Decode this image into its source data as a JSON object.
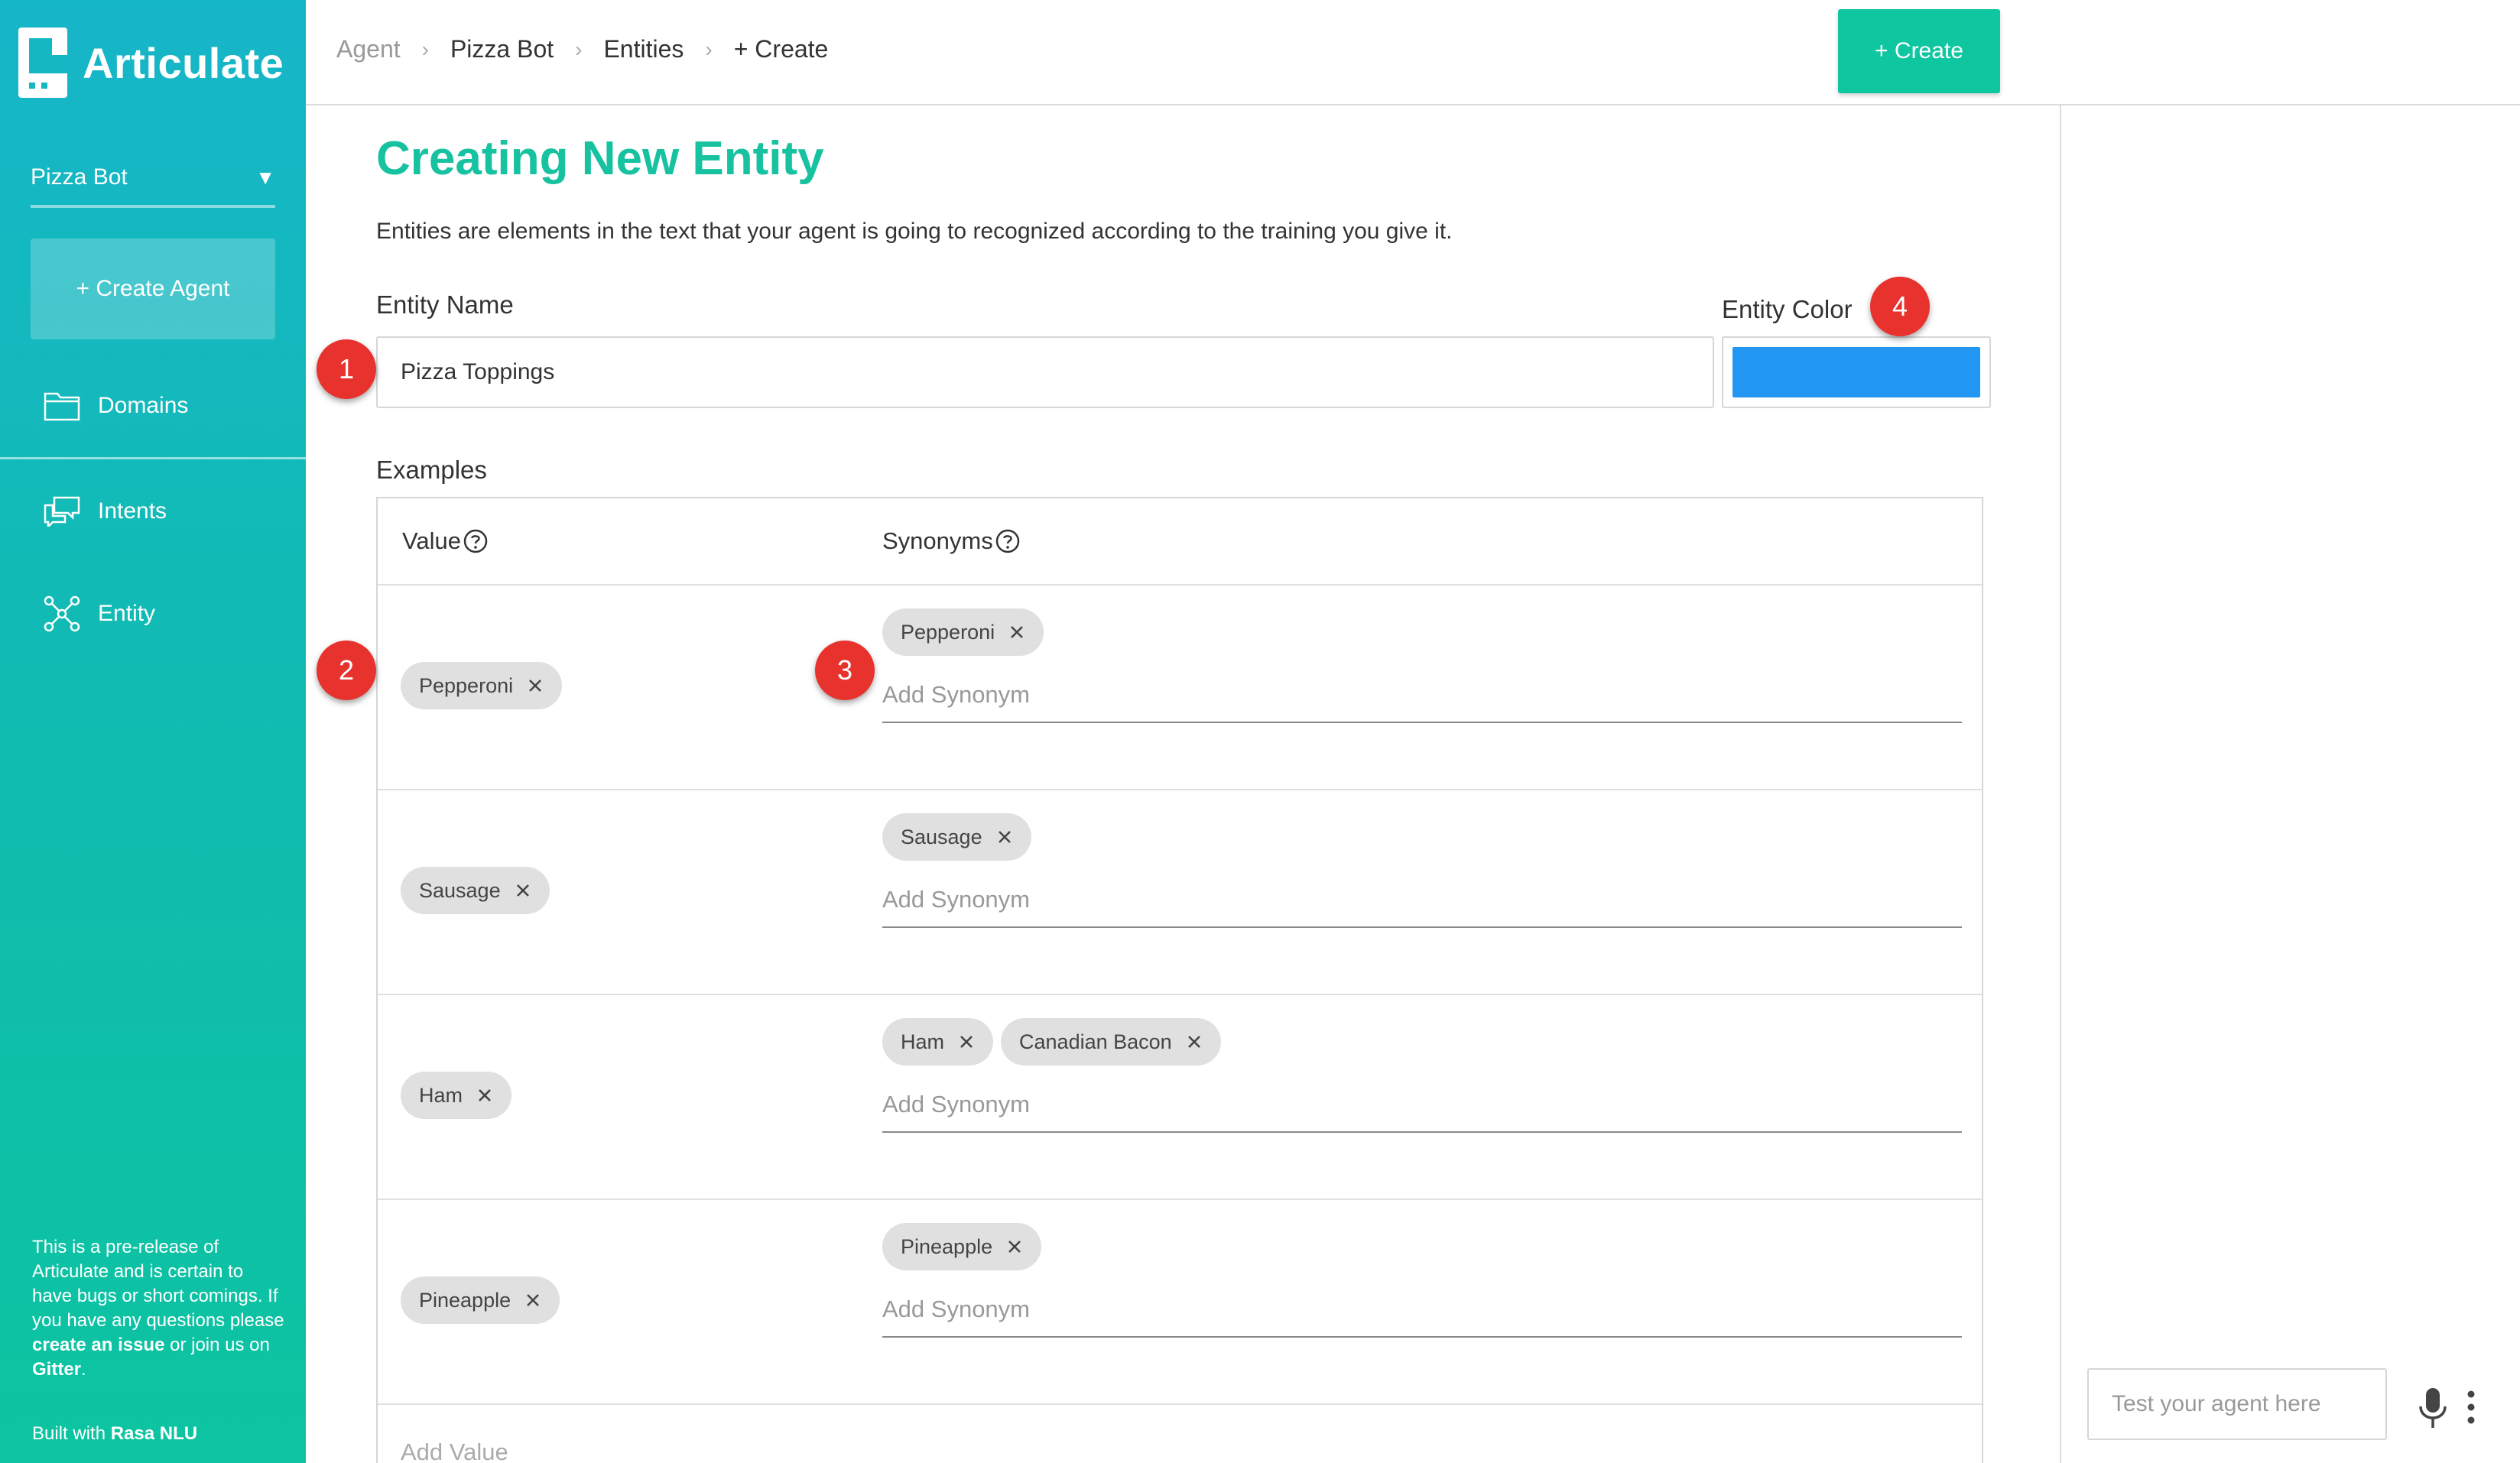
{
  "app": {
    "name": "Articulate",
    "colors": {
      "accent": "#0ec7a0",
      "sidebar_top": "#16b6c9",
      "sidebar_bottom": "#0cc4a0",
      "entity_color": "#2196f3",
      "callout": "#e8322e"
    }
  },
  "sidebar": {
    "agent_selected": "Pizza Bot",
    "create_agent_label": "+ Create Agent",
    "nav": [
      {
        "label": "Domains",
        "icon": "folder-icon"
      },
      {
        "label": "Intents",
        "icon": "chat-bubbles-icon"
      },
      {
        "label": "Entity",
        "icon": "network-nodes-icon"
      }
    ],
    "note": {
      "text1": "This is a pre-release of Articulate and is certain to have bugs or short comings. If you have any questions please ",
      "link1": "create an issue",
      "text2": " or join us on ",
      "link2": "Gitter",
      "text3": "."
    },
    "built_with_prefix": "Built with ",
    "built_with_link": "Rasa NLU"
  },
  "breadcrumb": [
    "Agent",
    "Pizza Bot",
    "Entities",
    "+ Create"
  ],
  "header": {
    "create_button": "+ Create"
  },
  "page": {
    "title": "Creating New Entity",
    "description": "Entities are elements in the text that your agent is going to recognized according to the training you give it.",
    "entity_name_label": "Entity Name",
    "entity_name_value": "Pizza Toppings",
    "entity_color_label": "Entity Color",
    "examples_label": "Examples"
  },
  "examples": {
    "value_header": "Value",
    "synonyms_header": "Synonyms",
    "add_synonym_placeholder": "Add Synonym",
    "add_value_placeholder": "Add Value",
    "rows": [
      {
        "value": "Pepperoni",
        "synonyms": [
          "Pepperoni"
        ]
      },
      {
        "value": "Sausage",
        "synonyms": [
          "Sausage"
        ]
      },
      {
        "value": "Ham",
        "synonyms": [
          "Ham",
          "Canadian Bacon"
        ]
      },
      {
        "value": "Pineapple",
        "synonyms": [
          "Pineapple"
        ]
      }
    ]
  },
  "test_panel": {
    "placeholder": "Test your agent here"
  },
  "callouts": [
    "1",
    "2",
    "3",
    "4"
  ]
}
